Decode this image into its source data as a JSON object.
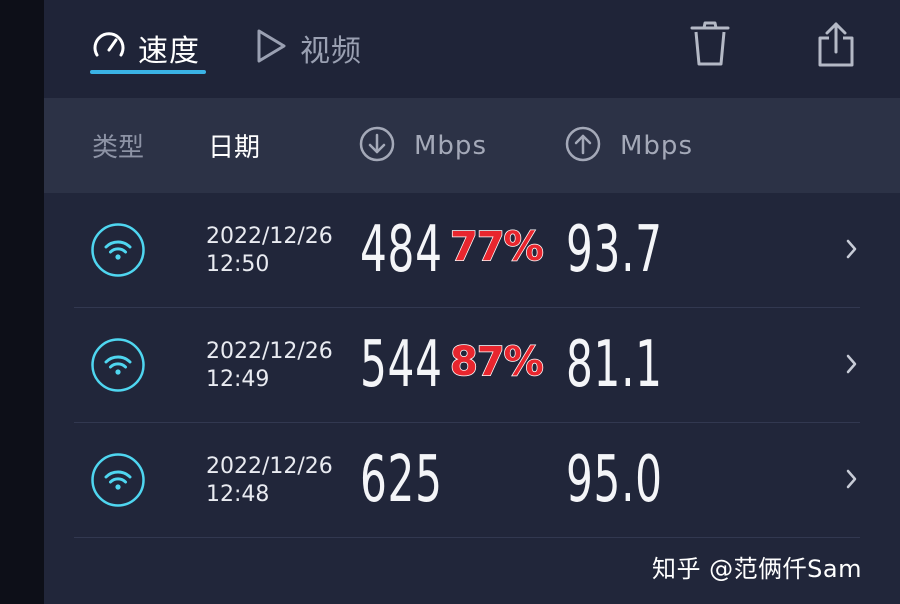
{
  "tabs": [
    {
      "label": "速度",
      "icon": "speedometer-icon",
      "active": true
    },
    {
      "label": "视频",
      "icon": "play-icon",
      "active": false
    }
  ],
  "toolbar": {
    "delete_icon": "trash-icon",
    "share_icon": "share-icon"
  },
  "table_header": {
    "type": "类型",
    "date": "日期",
    "download_unit": "Mbps",
    "upload_unit": "Mbps"
  },
  "results": [
    {
      "date": "2022/12/26",
      "time": "12:50",
      "download": "484",
      "upload": "93.7",
      "annotation": "77%"
    },
    {
      "date": "2022/12/26",
      "time": "12:49",
      "download": "544",
      "upload": "81.1",
      "annotation": "87%"
    },
    {
      "date": "2022/12/26",
      "time": "12:48",
      "download": "625",
      "upload": "95.0",
      "annotation": ""
    }
  ],
  "watermark": "知乎 @范俩仟Sam",
  "colors": {
    "accent": "#3ab3e6",
    "wifi": "#4fd6f0",
    "annotation_red": "#e8262e",
    "background": "#21263a",
    "header_bg": "#2c3246"
  }
}
